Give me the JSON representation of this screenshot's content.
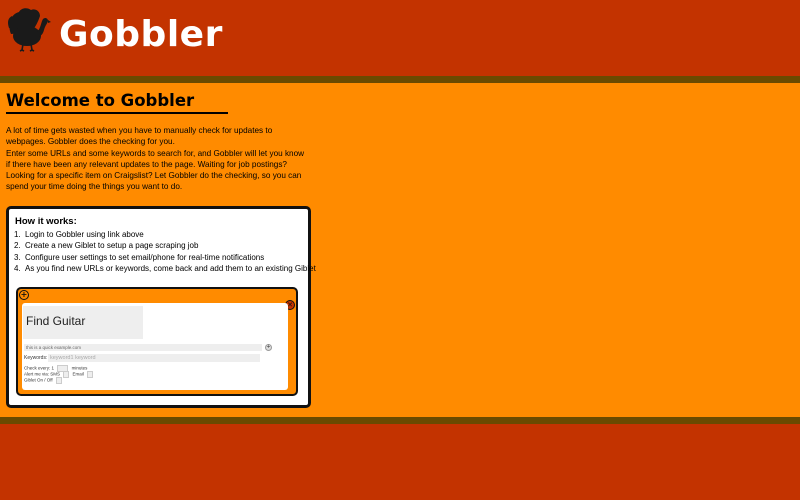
{
  "header": {
    "brand": "Gobbler",
    "logo_icon": "turkey-icon"
  },
  "colors": {
    "header_bg": "#c33300",
    "main_bg": "#ff8b00",
    "band": "#6a4a00"
  },
  "main": {
    "welcome_title": "Welcome to Gobbler",
    "intro": [
      "A lot of time gets wasted when you have to manually check for updates to webpages. Gobbler does the checking for you.",
      "Enter some URLs and some keywords to search for, and Gobbler will let you know if there have been any relevant updates to the page. Waiting for job postings? Looking for a specific item on Craigslist? Let Gobbler do the checking, so you can spend your time doing the things you want to do."
    ],
    "how_it_works": {
      "title": "How it works:",
      "steps": [
        {
          "num": "1.",
          "text": "Login to Gobbler using link above"
        },
        {
          "num": "2.",
          "text": "Create a new Giblet to setup a page scraping job"
        },
        {
          "num": "3.",
          "text": "Configure user settings to set email/phone for real-time notifications"
        },
        {
          "num": "4.",
          "text": "As you find new URLs or keywords, come back and add them to an existing Giblet"
        }
      ]
    },
    "giblet_preview": {
      "title": "Find Guitar",
      "url": "this is a quick example.com",
      "keywords_label": "Keywords:",
      "keywords_placeholder": "keyword1 keyword",
      "check_every_label": "Check every:",
      "check_every_value": "1",
      "check_every_unit": "minutes",
      "alert_label": "Alert me via: SMS",
      "alert_email": "Email",
      "onoff_label": "Giblet On / Off"
    }
  }
}
